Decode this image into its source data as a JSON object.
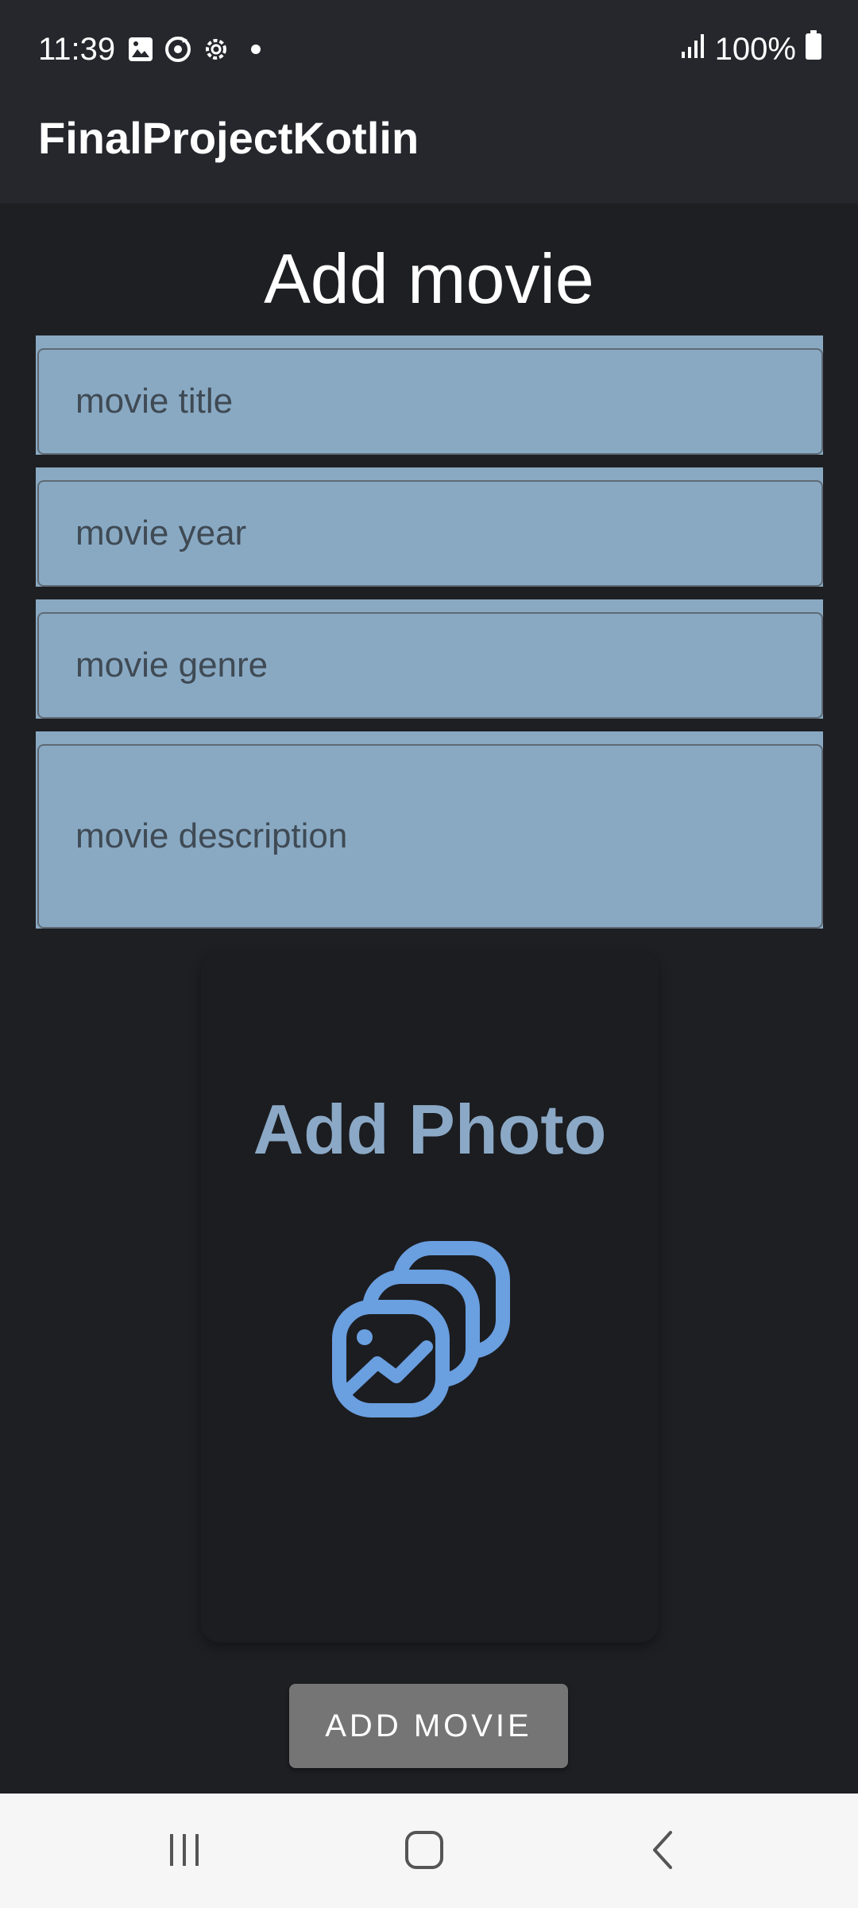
{
  "status_bar": {
    "time": "11:39",
    "battery": "100%",
    "icons": [
      "image-icon",
      "sync-icon",
      "settings-icon",
      "dot-icon",
      "signal-icon",
      "battery-icon"
    ]
  },
  "app_bar": {
    "title": "FinalProjectKotlin"
  },
  "form": {
    "heading": "Add movie",
    "title_placeholder": "movie title",
    "year_placeholder": "movie year",
    "genre_placeholder": "movie genre",
    "description_placeholder": "movie description"
  },
  "photo": {
    "label": "Add Photo",
    "icon": "photo-library-icon"
  },
  "submit": {
    "label": "ADD MOVIE"
  },
  "nav_bar": {
    "icons": [
      "recents-icon",
      "home-icon",
      "back-icon"
    ]
  },
  "colors": {
    "background": "#1e1f23",
    "app_bar": "#25272c",
    "field": "#89a9c3",
    "accent": "#8ba9c6",
    "photo_icon": "#6a9fe0",
    "button": "#757575"
  }
}
